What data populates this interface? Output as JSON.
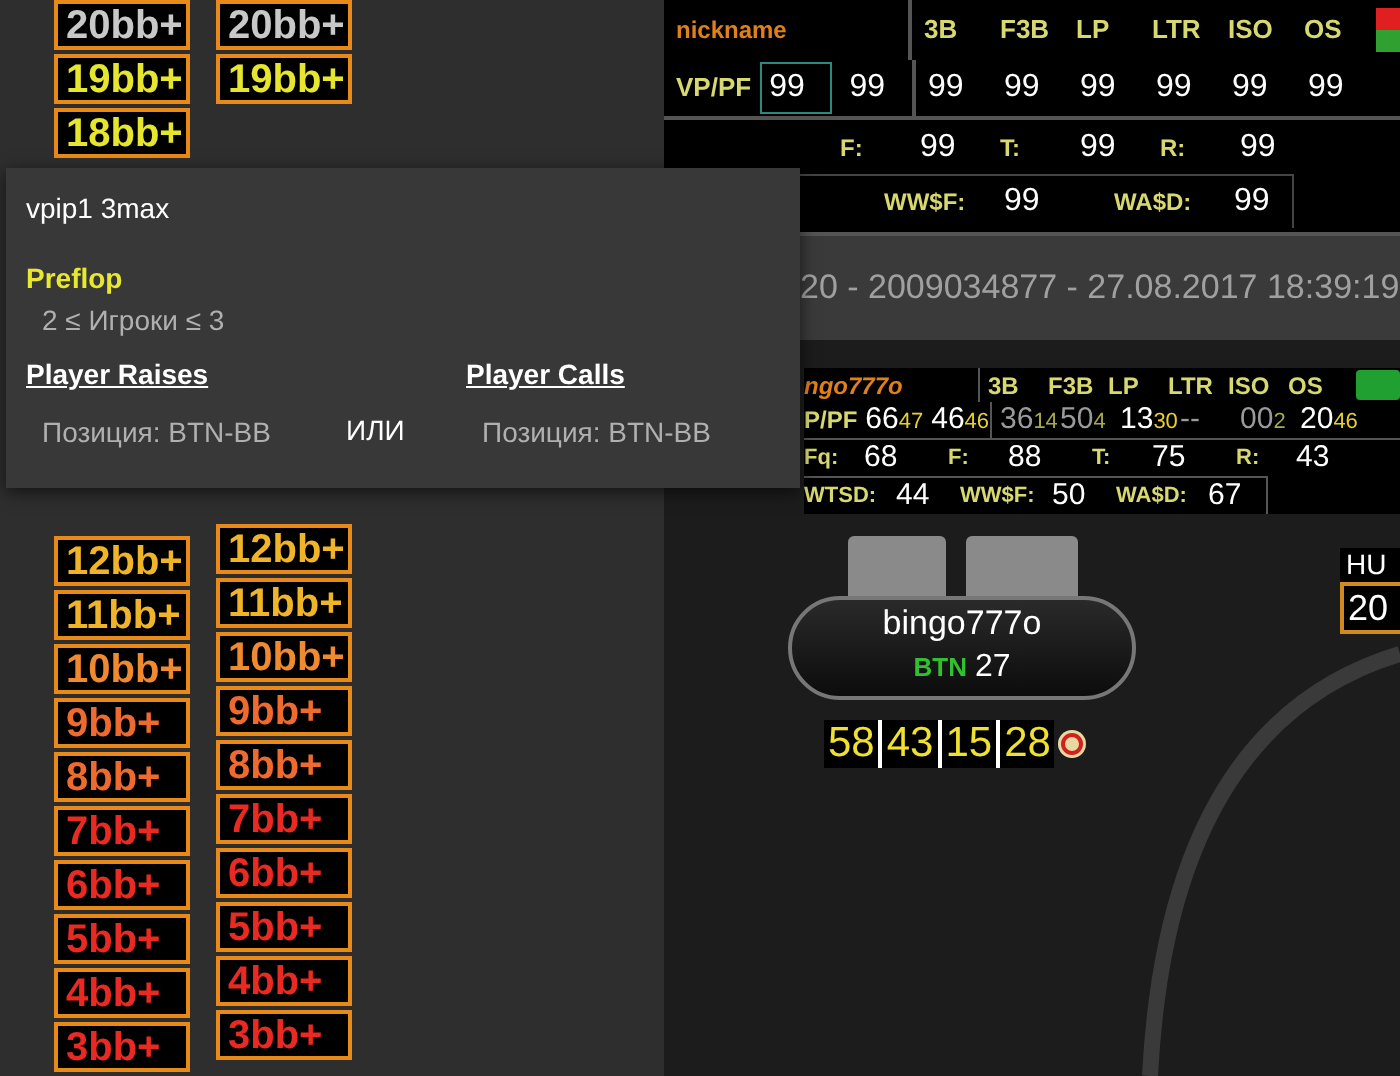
{
  "bb_columns": [
    {
      "upper": [
        {
          "label": "20bb+",
          "kind": "neutral"
        },
        {
          "label": "19bb+",
          "kind": "high"
        },
        {
          "label": "18bb+",
          "kind": "high"
        }
      ],
      "lower": [
        {
          "label": "12bb+",
          "kind": "upper"
        },
        {
          "label": "11bb+",
          "kind": "upper"
        },
        {
          "label": "10bb+",
          "kind": "middle"
        },
        {
          "label": "9bb+",
          "kind": "lower"
        },
        {
          "label": "8bb+",
          "kind": "lower"
        },
        {
          "label": "7bb+",
          "kind": "low"
        },
        {
          "label": "6bb+",
          "kind": "low"
        },
        {
          "label": "5bb+",
          "kind": "low"
        },
        {
          "label": "4bb+",
          "kind": "low"
        },
        {
          "label": "3bb+",
          "kind": "low"
        }
      ]
    },
    {
      "upper": [
        {
          "label": "20bb+",
          "kind": "neutral"
        },
        {
          "label": "19bb+",
          "kind": "high"
        }
      ],
      "lower": [
        {
          "label": "12bb+",
          "kind": "upper"
        },
        {
          "label": "11bb+",
          "kind": "upper"
        },
        {
          "label": "10bb+",
          "kind": "middle"
        },
        {
          "label": "9bb+",
          "kind": "lower"
        },
        {
          "label": "8bb+",
          "kind": "lower"
        },
        {
          "label": "7bb+",
          "kind": "low"
        },
        {
          "label": "6bb+",
          "kind": "low"
        },
        {
          "label": "5bb+",
          "kind": "low"
        },
        {
          "label": "4bb+",
          "kind": "low"
        },
        {
          "label": "3bb+",
          "kind": "low"
        }
      ]
    }
  ],
  "popup": {
    "title": "vpip1 3max",
    "section": "Preflop",
    "condition": "2 ≤ Игроки ≤ 3",
    "joiner": "ИЛИ",
    "branches": [
      {
        "heading": "Player Raises",
        "detail": "Позиция: BTN-BB"
      },
      {
        "heading": "Player Calls",
        "detail": "Позиция: BTN-BB"
      }
    ]
  },
  "hud_top": {
    "nickname": "nickname",
    "headers": [
      "3B",
      "F3B",
      "LP",
      "LTR",
      "ISO",
      "OS"
    ],
    "vpip_label": "VP/PF",
    "vpip_values": [
      {
        "value": "99",
        "selected": true
      },
      {
        "value": "99",
        "selected": false
      }
    ],
    "values": [
      "99",
      "99",
      "99",
      "99",
      "99",
      "99"
    ],
    "row3": [
      {
        "label": "F:",
        "value": "99"
      },
      {
        "label": "T:",
        "value": "99"
      },
      {
        "label": "R:",
        "value": "99"
      }
    ],
    "row4": [
      {
        "label": "WW$F:",
        "value": "99"
      },
      {
        "label": "WA$D:",
        "value": "99"
      }
    ]
  },
  "table_title": "20 - 2009034877 - 27.08.2017 18:39:19",
  "hud_player": {
    "nickname": "ngo777o",
    "headers": [
      "3B",
      "F3B",
      "LP",
      "LTR",
      "ISO",
      "OS"
    ],
    "vpip_label": "P/PF",
    "vpip_values": [
      {
        "main": "66",
        "sub": "47",
        "dim": false
      },
      {
        "main": "46",
        "sub": "46",
        "dim": false
      }
    ],
    "values": [
      {
        "main": "36",
        "sub": "14",
        "dim": true
      },
      {
        "main": "50",
        "sub": "4",
        "dim": true
      },
      {
        "main": "13",
        "sub": "30",
        "dim": false
      },
      {
        "main": "--",
        "dim": true
      },
      {
        "main": "00",
        "sub": "2",
        "dim": true
      },
      {
        "main": "20",
        "sub": "46",
        "dim": false
      }
    ],
    "row3": [
      {
        "label": "Fq:",
        "value": "68"
      },
      {
        "label": "F:",
        "value": "88"
      },
      {
        "label": "T:",
        "value": "75"
      },
      {
        "label": "R:",
        "value": "43"
      }
    ],
    "row4": [
      {
        "label": "WTSD:",
        "value": "44"
      },
      {
        "label": "WW$F:",
        "value": "50"
      },
      {
        "label": "WA$D:",
        "value": "67"
      }
    ]
  },
  "seat": {
    "name": "bingo777o",
    "position": "BTN",
    "stack": "27",
    "stats": [
      "58",
      "43",
      "15",
      "28"
    ]
  },
  "hu": {
    "label": "HU",
    "value": "20"
  }
}
